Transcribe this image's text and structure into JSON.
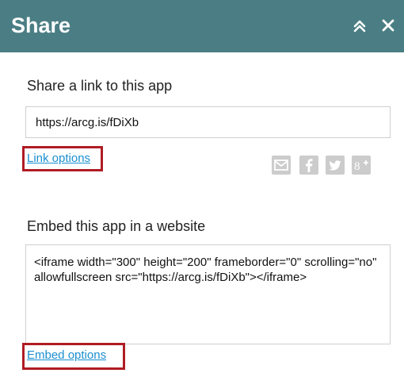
{
  "header": {
    "title": "Share",
    "collapse_icon": "double-chevron-up-icon",
    "close_icon": "close-icon",
    "background_color": "#4a7e84"
  },
  "share_link": {
    "label": "Share a link to this app",
    "url": "https://arcg.is/fDiXb",
    "options_link": "Link options"
  },
  "social": {
    "icons": [
      "mail-icon",
      "facebook-icon",
      "twitter-icon",
      "google-plus-icon"
    ],
    "icon_color": "#cccccc"
  },
  "embed": {
    "label": "Embed this app in a website",
    "code": "<iframe width=\"300\" height=\"200\" frameborder=\"0\" scrolling=\"no\" allowfullscreen src=\"https://arcg.is/fDiXb\"></iframe>",
    "options_link": "Embed options"
  },
  "colors": {
    "link": "#1a8fd0",
    "highlight_box": "#b01c24"
  }
}
